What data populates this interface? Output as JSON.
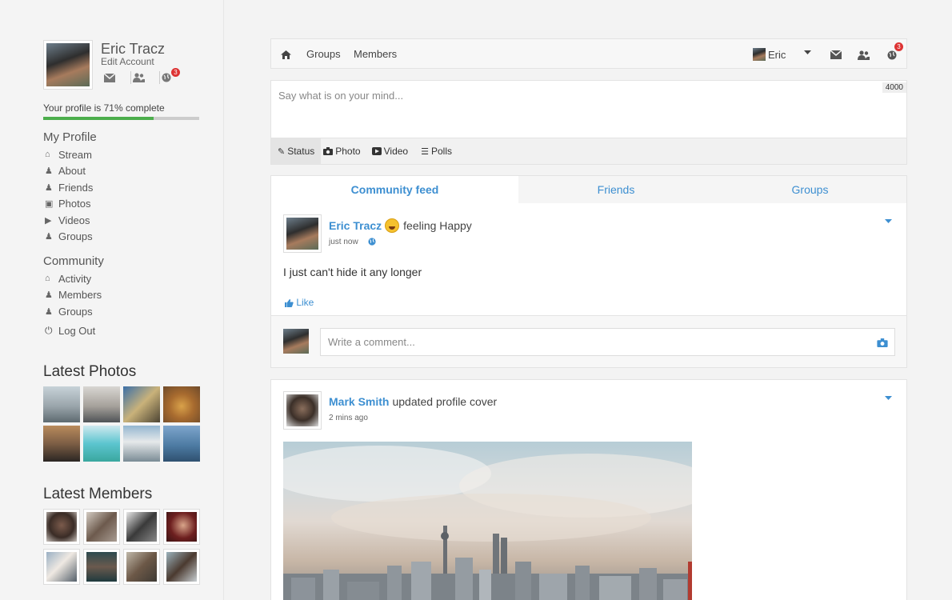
{
  "sidebar": {
    "user_name": "Eric Tracz",
    "edit_account": "Edit Account",
    "notification_count": "3",
    "progress_label": "Your profile is 71% complete",
    "progress_percent": 71,
    "my_profile_title": "My Profile",
    "my_profile_items": [
      {
        "label": "Stream",
        "icon": "home-icon"
      },
      {
        "label": "About",
        "icon": "user-icon"
      },
      {
        "label": "Friends",
        "icon": "users-icon"
      },
      {
        "label": "Photos",
        "icon": "camera-icon"
      },
      {
        "label": "Videos",
        "icon": "video-icon"
      },
      {
        "label": "Groups",
        "icon": "group-icon"
      }
    ],
    "community_title": "Community",
    "community_items": [
      {
        "label": "Activity",
        "icon": "home-icon"
      },
      {
        "label": "Members",
        "icon": "users-icon"
      },
      {
        "label": "Groups",
        "icon": "group-icon"
      }
    ],
    "logout_label": "Log Out",
    "latest_photos_title": "Latest Photos",
    "latest_members_title": "Latest Members"
  },
  "topbar": {
    "nav_groups": "Groups",
    "nav_members": "Members",
    "user_label": "Eric",
    "notification_count": "3"
  },
  "composer": {
    "placeholder": "Say what is on your mind...",
    "char_counter": "4000",
    "tabs": [
      {
        "label": "Status",
        "icon": "pencil-icon"
      },
      {
        "label": "Photo",
        "icon": "camera-icon"
      },
      {
        "label": "Video",
        "icon": "video-icon"
      },
      {
        "label": "Polls",
        "icon": "list-icon"
      }
    ]
  },
  "feed_tabs": [
    "Community feed",
    "Friends",
    "Groups"
  ],
  "posts": [
    {
      "author": "Eric Tracz",
      "action": "feeling Happy",
      "time": "just now",
      "text": "I just can't hide it any longer",
      "like_label": "Like",
      "comment_placeholder": "Write a comment..."
    },
    {
      "author": "Mark Smith",
      "action": "updated profile cover",
      "time": "2 mins ago"
    }
  ],
  "colors": {
    "accent": "#3d8fd1",
    "progress": "#4cae4c",
    "badge": "#dd3333"
  }
}
